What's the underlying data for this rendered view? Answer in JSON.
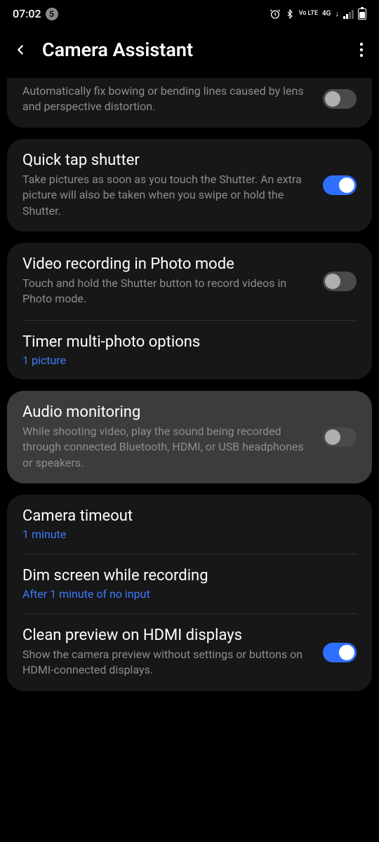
{
  "status": {
    "time": "07:02",
    "notification_count": "5",
    "network_label": "Vo LTE",
    "network_type": "4G"
  },
  "header": {
    "title": "Camera Assistant"
  },
  "settings": {
    "distortion": {
      "desc": "Automatically fix bowing or bending lines caused by lens and perspective distortion."
    },
    "quick_tap": {
      "title": "Quick tap shutter",
      "desc": "Take pictures as soon as you touch the Shutter. An extra picture will also be taken when you swipe or hold the Shutter."
    },
    "video_photo": {
      "title": "Video recording in Photo mode",
      "desc": "Touch and hold the Shutter button to record videos in Photo mode."
    },
    "timer": {
      "title": "Timer multi-photo options",
      "value": "1 picture"
    },
    "audio": {
      "title": "Audio monitoring",
      "desc": "While shooting video, play the sound being recorded through connected Bluetooth, HDMI, or USB headphones or speakers."
    },
    "timeout": {
      "title": "Camera timeout",
      "value": "1 minute"
    },
    "dim": {
      "title": "Dim screen while recording",
      "value": "After 1 minute of no input"
    },
    "hdmi": {
      "title": "Clean preview on HDMI displays",
      "desc": "Show the camera preview without settings or buttons on HDMI-connected displays."
    }
  }
}
